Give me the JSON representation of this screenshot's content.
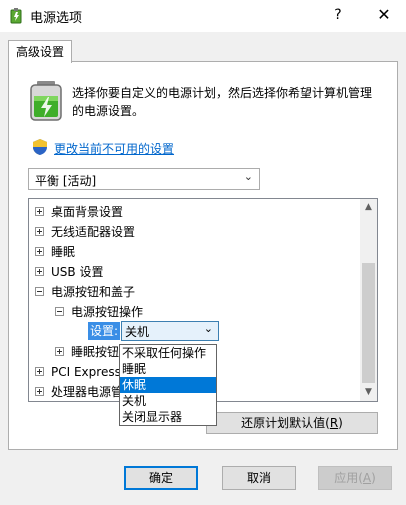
{
  "window": {
    "title": "电源选项",
    "help_glyph": "?",
    "close_glyph": "✕"
  },
  "tabs": [
    {
      "label": "高级设置"
    }
  ],
  "header": {
    "description": "选择你要自定义的电源计划，然后选择你希望计算机管理的电源设置。",
    "change_link": "更改当前不可用的设置"
  },
  "plan": {
    "selected": "平衡 [活动]"
  },
  "tree": {
    "items": [
      {
        "label": "桌面背景设置",
        "expanded": false
      },
      {
        "label": "无线适配器设置",
        "expanded": false
      },
      {
        "label": "睡眠",
        "expanded": false
      },
      {
        "label": "USB 设置",
        "expanded": false
      },
      {
        "label": "电源按钮和盖子",
        "expanded": true
      },
      {
        "label": "电源按钮操作",
        "expanded": true
      },
      {
        "label": "睡眠按钮",
        "expanded": false
      },
      {
        "label": "PCI Express",
        "expanded": false
      },
      {
        "label": "处理器电源管",
        "expanded": false
      }
    ],
    "setting_label": "设置:",
    "setting_value": "关机"
  },
  "dropdown": {
    "options": [
      "不采取任何操作",
      "睡眠",
      "休眠",
      "关机",
      "关闭显示器"
    ],
    "highlighted_index": 2
  },
  "buttons": {
    "restore": "还原计划默认值",
    "restore_key": "R",
    "ok": "确定",
    "cancel": "取消",
    "apply": "应用",
    "apply_key": "A"
  },
  "colors": {
    "accent": "#0078d7",
    "link": "#0066cc"
  }
}
